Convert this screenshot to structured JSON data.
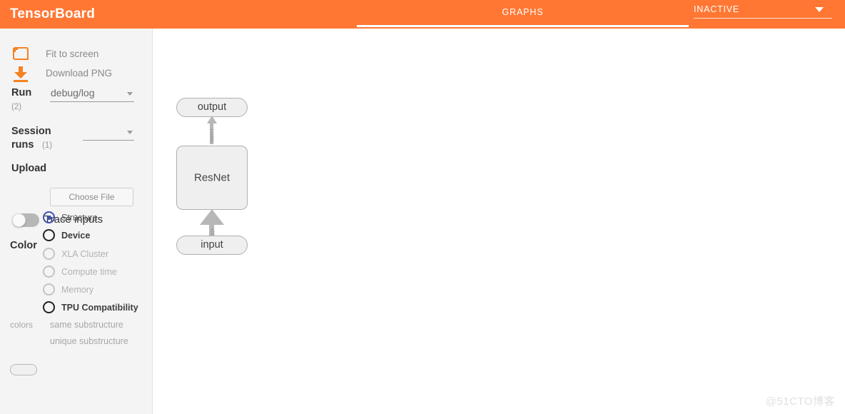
{
  "header": {
    "brand": "TensorBoard",
    "active_tab": "GRAPHS",
    "runs_selector": {
      "value": "INACTIVE",
      "caret_icon": "chevron-down-icon"
    },
    "accent_color": "#ff7733"
  },
  "sidebar": {
    "actions": [
      {
        "label": "Fit to screen",
        "icon": "fit-to-screen-icon"
      },
      {
        "label": "Download PNG",
        "icon": "download-icon"
      }
    ],
    "run": {
      "label": "Run",
      "count": "(2)",
      "value": "debug/log",
      "caret_icon": "chevron-down-icon"
    },
    "session_runs": {
      "label_line1": "Session",
      "label_line2": "runs",
      "count": "(1)",
      "value": "",
      "caret_icon": "chevron-down-icon"
    },
    "upload": {
      "label": "Upload",
      "button_label": "Choose File"
    },
    "trace_inputs": {
      "label": "Trace inputs",
      "state": "off"
    },
    "color": {
      "label": "Color",
      "selected": "Structure",
      "options": [
        {
          "label": "Structure",
          "state": "selected"
        },
        {
          "label": "Device",
          "state": "enabled"
        },
        {
          "label": "XLA Cluster",
          "state": "disabled"
        },
        {
          "label": "Compute time",
          "state": "disabled"
        },
        {
          "label": "Memory",
          "state": "disabled"
        },
        {
          "label": "TPU Compatibility",
          "state": "enabled"
        }
      ]
    },
    "legend": {
      "key": "colors",
      "same_substructure": "same substructure",
      "unique_substructure": "unique substructure"
    }
  },
  "graph": {
    "nodes": [
      {
        "id": "output",
        "label": "output",
        "shape": "pill"
      },
      {
        "id": "resnet",
        "label": "ResNet",
        "shape": "box"
      },
      {
        "id": "input",
        "label": "input",
        "shape": "pill"
      }
    ],
    "edges": [
      {
        "from": "resnet",
        "to": "output",
        "label": "1x1000"
      },
      {
        "from": "input",
        "to": "resnet",
        "label": "x224"
      }
    ]
  },
  "watermark": "@51CTO博客"
}
